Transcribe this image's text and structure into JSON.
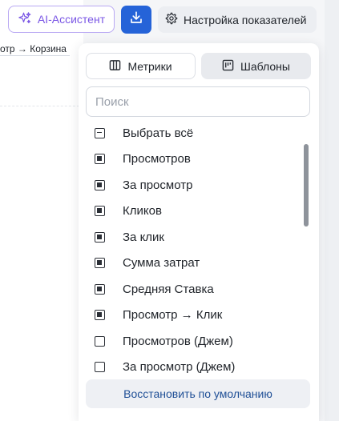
{
  "toolbar": {
    "ai_assistant_label": "AI-Ассистент",
    "download_icon": "download-icon",
    "settings_label": "Настройка показателей"
  },
  "background": {
    "breadcrumb_text": "отр → Корзина"
  },
  "panel": {
    "tabs": [
      {
        "label": "Метрики",
        "icon": "columns-icon"
      },
      {
        "label": "Шаблоны",
        "icon": "template-icon"
      }
    ],
    "search": {
      "placeholder": "Поиск",
      "value": ""
    },
    "items": [
      {
        "label": "Выбрать всё",
        "state": "indeterminate"
      },
      {
        "label": "Просмотров",
        "state": "checked"
      },
      {
        "label": "За просмотр",
        "state": "checked"
      },
      {
        "label": "Кликов",
        "state": "checked"
      },
      {
        "label": "За клик",
        "state": "checked"
      },
      {
        "label": "Сумма затрат",
        "state": "checked"
      },
      {
        "label": "Средняя Ставка",
        "state": "checked"
      },
      {
        "label": "Просмотр → Клик",
        "state": "checked"
      },
      {
        "label": "Просмотров (Джем)",
        "state": "unchecked"
      },
      {
        "label": "За просмотр (Джем)",
        "state": "unchecked"
      }
    ],
    "restore_label": "Восстановить по умолчанию"
  },
  "colors": {
    "accent": "#2563d8",
    "ai_purple": "#7a56e5",
    "link_blue": "#1f4f96"
  }
}
